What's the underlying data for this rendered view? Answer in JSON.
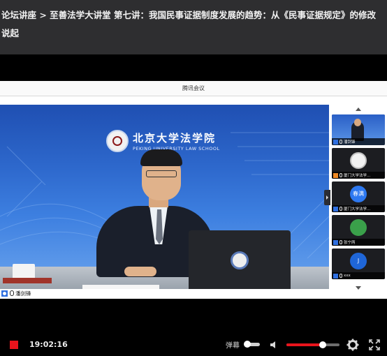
{
  "page": {
    "title": "论坛讲座 > 至善法学大讲堂 第七讲：我国民事证据制度发展的趋势：从《民事证据规定》的修改说起"
  },
  "meeting": {
    "window_title": "腾讯会议",
    "main_speaker_name": "潘剑锋",
    "backdrop": {
      "school_name_cn": "北京大学法学院",
      "school_name_en": "PEKING UNIVERSITY LAW SCHOOL"
    },
    "participants": [
      {
        "name": "潘剑锋",
        "avatar": "video",
        "avatar_text": "",
        "caption_icon": "user-icon"
      },
      {
        "name": "厦门大学法学...",
        "avatar": "seal",
        "avatar_text": "",
        "caption_icon": "host-icon"
      },
      {
        "name": "厦门大学法学...",
        "avatar": "blue",
        "avatar_text": "春满",
        "caption_icon": "user-icon"
      },
      {
        "name": "张宁两",
        "avatar": "green",
        "avatar_text": "",
        "caption_icon": "user-icon"
      },
      {
        "name": "xxx",
        "avatar": "blue2",
        "avatar_text": "J",
        "caption_icon": "user-icon"
      }
    ]
  },
  "player": {
    "time": "19:02:16",
    "danmu_label": "弹幕",
    "danmu_enabled": false,
    "volume_level": 0.68,
    "accent_color": "#e8141c",
    "icons": [
      "stop-icon",
      "volume-icon",
      "gear-icon",
      "fullscreen-icon"
    ]
  }
}
